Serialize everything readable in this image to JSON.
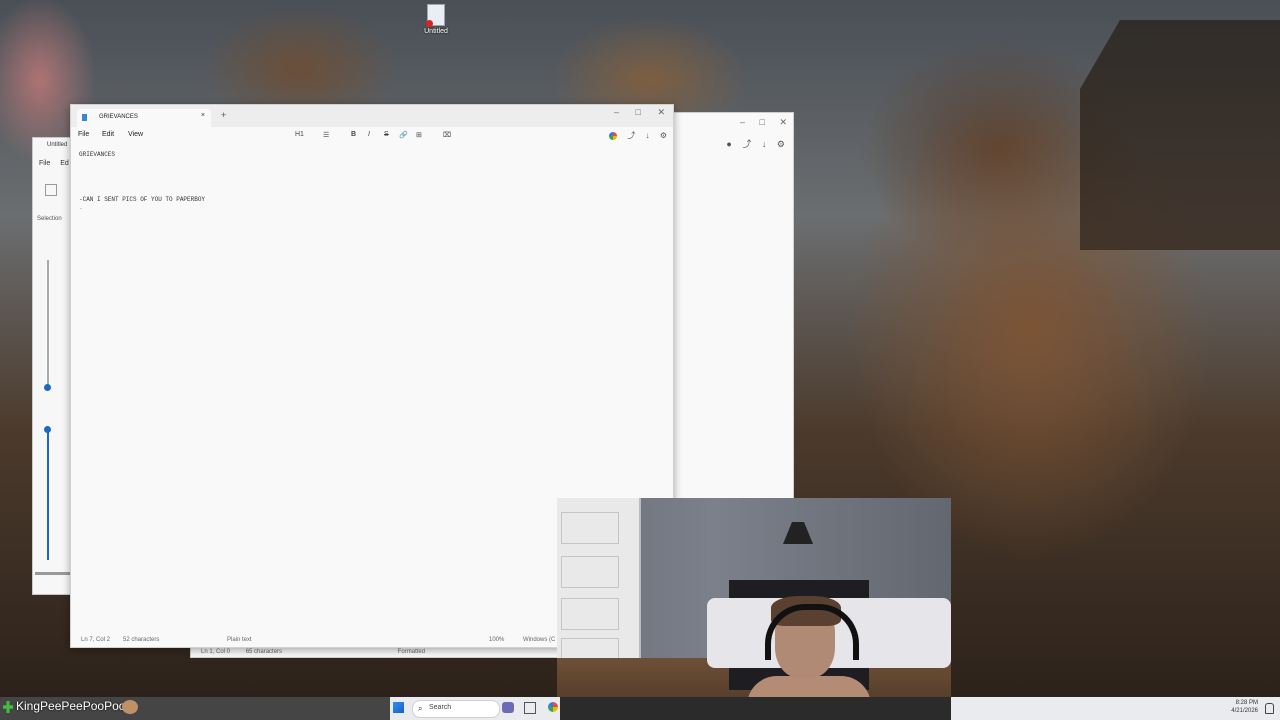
{
  "desktop": {
    "icon_label": "Untitled"
  },
  "paint_window": {
    "title": "Untitled",
    "menu": [
      "File",
      "Ed"
    ],
    "selection_label": "Selection"
  },
  "notepad_back": {
    "status": [
      "Ln 1, Col 0",
      "65 characters",
      "Formatted"
    ]
  },
  "notepad": {
    "tab_title": "GRIEVANCES",
    "close_glyph": "×",
    "new_tab_glyph": "+",
    "caption": [
      "–",
      "□",
      "✕"
    ],
    "menu": [
      "File",
      "Edit",
      "View"
    ],
    "format_tools": {
      "heading": "H1",
      "list": "☰",
      "bold": "B",
      "italic": "I",
      "strike": "S",
      "link": "🔗",
      "table": "⊞",
      "clear": "⌧"
    },
    "content": {
      "line1": "GRIEVANCES",
      "line2": "-CAN I SENT PICS OF YOU TO PAPERBOY",
      "line3": "-"
    },
    "status": {
      "position": "Ln 7, Col 2",
      "chars": "52 characters",
      "format": "Plain text",
      "zoom": "100%",
      "eol": "Windows (C"
    }
  },
  "taskbar": {
    "chat_username": "KingPeePeePooPoo :",
    "search_placeholder": "Search",
    "time": "8:28 PM",
    "date": "4/21/2026"
  }
}
